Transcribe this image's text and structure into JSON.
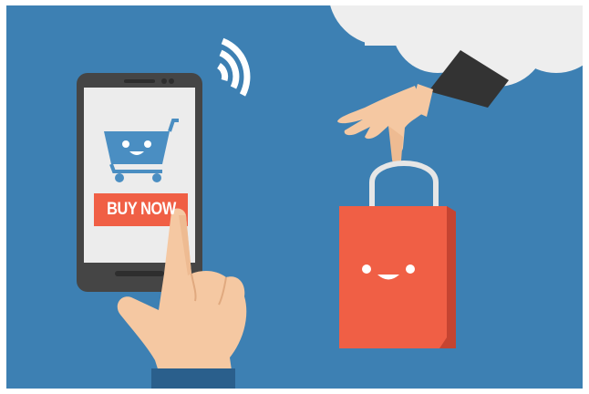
{
  "illustration": {
    "phone": {
      "buy_button_label": "BUY NOW"
    },
    "icons": {
      "cart": "shopping-cart-icon",
      "signal": "wireless-signal-icon",
      "bag": "shopping-bag-icon",
      "cloud": "cloud-icon"
    },
    "colors": {
      "background": "#3d80b3",
      "button": "#f05f45",
      "bag": "#f05f45",
      "cart": "#4a8ec2",
      "cloud": "#eeeeee",
      "phone_body": "#454545",
      "skin": "#f5c8a2"
    }
  }
}
